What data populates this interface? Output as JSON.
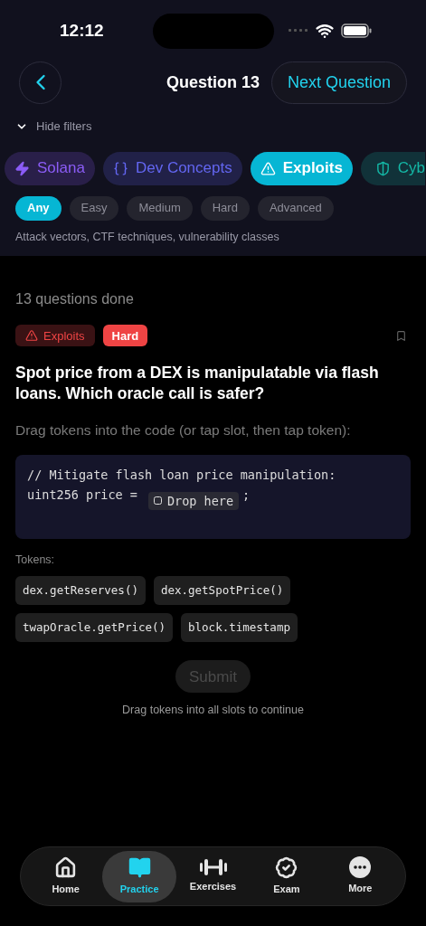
{
  "status_bar": {
    "time": "12:12"
  },
  "header": {
    "title": "Question 13",
    "next_button": "Next Question"
  },
  "filters": {
    "toggle": "Hide filters",
    "expanded": true,
    "categories": [
      {
        "label": "Solana",
        "kind": "zap",
        "color": "#8b5cf6",
        "selected": false
      },
      {
        "label": "Dev Concepts",
        "kind": "braces",
        "color": "#6366f1",
        "selected": false
      },
      {
        "label": "Exploits",
        "kind": "alert",
        "color": "#06b6d4",
        "selected": true
      },
      {
        "label": "Cyb",
        "kind": "shield",
        "color": "#14b8a6",
        "selected": false
      }
    ],
    "difficulties": [
      {
        "label": "Any",
        "selected": true
      },
      {
        "label": "Easy",
        "selected": false
      },
      {
        "label": "Medium",
        "selected": false
      },
      {
        "label": "Hard",
        "selected": false
      },
      {
        "label": "Advanced",
        "selected": false
      }
    ],
    "description": "Attack vectors, CTF techniques, vulnerability classes"
  },
  "progress": "13 questions done",
  "question": {
    "category_tag": "Exploits",
    "difficulty_tag": "Hard",
    "bookmarked": false,
    "text": "Spot price from a DEX is manipulatable via flash loans. Which oracle call is safer?",
    "instruction": "Drag tokens into the code (or tap slot, then tap token):",
    "code": {
      "comment": "// Mitigate flash loan price manipulation:",
      "prefix": "uint256 price =",
      "slot": "Drop here",
      "suffix": ";"
    },
    "tokens_label": "Tokens:",
    "tokens": [
      "dex.getReserves()",
      "dex.getSpotPrice()",
      "twapOracle.getPrice()",
      "block.timestamp"
    ],
    "submit": {
      "label": "Submit",
      "disabled": true
    },
    "hint": "Drag tokens into all slots to continue"
  },
  "tab_bar": [
    {
      "label": "Home",
      "kind": "home",
      "selected": false
    },
    {
      "label": "Practice",
      "kind": "book",
      "selected": true
    },
    {
      "label": "Exercises",
      "kind": "dumbbell",
      "selected": false
    },
    {
      "label": "Exam",
      "kind": "badge",
      "selected": false
    },
    {
      "label": "More",
      "kind": "more",
      "selected": false
    }
  ]
}
